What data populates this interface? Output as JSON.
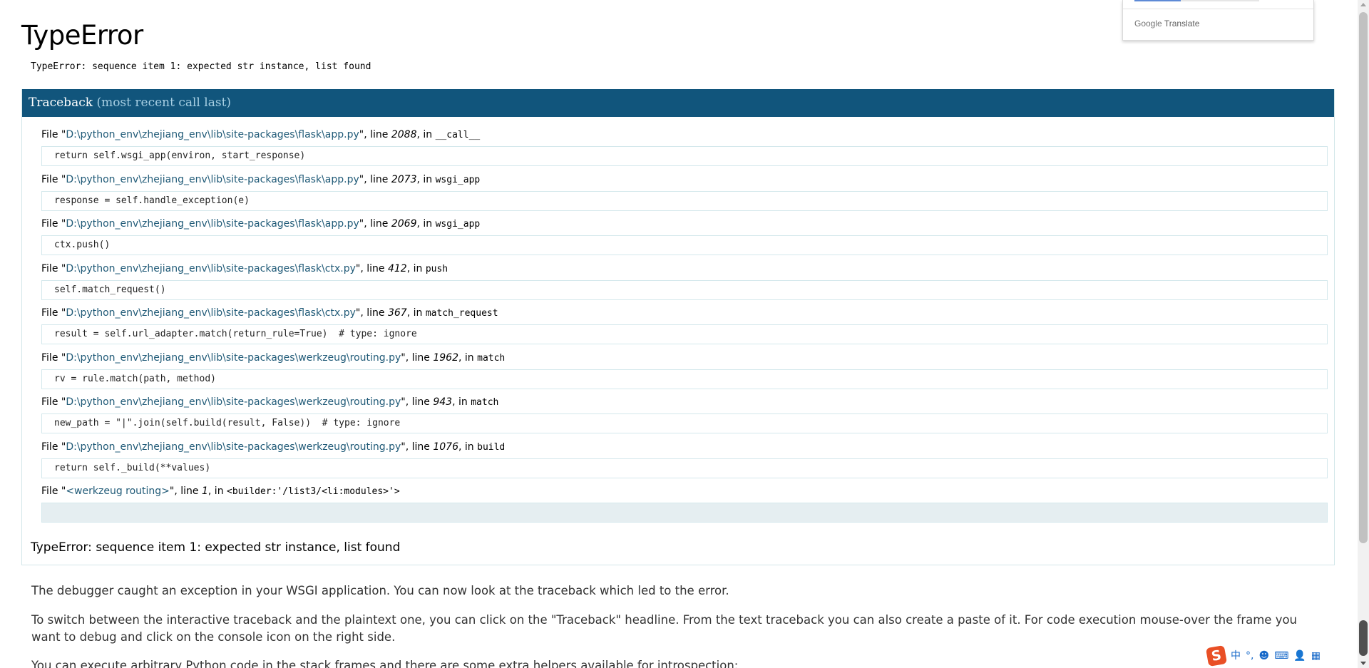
{
  "page": {
    "title": "TypeError",
    "error_message": "TypeError: sequence item 1: expected str instance, list found"
  },
  "traceback": {
    "header_main": "Traceback",
    "header_sub": "(most recent call last)",
    "frames": [
      {
        "file_prefix": "File \"",
        "filename": "D:\\python_env\\zhejiang_env\\lib\\site-packages\\flask\\app.py",
        "line_label": "\", line ",
        "lineno": "2088",
        "in_label": ", in ",
        "function": "__call__",
        "code": "return self.wsgi_app(environ, start_response)"
      },
      {
        "file_prefix": "File \"",
        "filename": "D:\\python_env\\zhejiang_env\\lib\\site-packages\\flask\\app.py",
        "line_label": "\", line ",
        "lineno": "2073",
        "in_label": ", in ",
        "function": "wsgi_app",
        "code": "response = self.handle_exception(e)"
      },
      {
        "file_prefix": "File \"",
        "filename": "D:\\python_env\\zhejiang_env\\lib\\site-packages\\flask\\app.py",
        "line_label": "\", line ",
        "lineno": "2069",
        "in_label": ", in ",
        "function": "wsgi_app",
        "code": "ctx.push()"
      },
      {
        "file_prefix": "File \"",
        "filename": "D:\\python_env\\zhejiang_env\\lib\\site-packages\\flask\\ctx.py",
        "line_label": "\", line ",
        "lineno": "412",
        "in_label": ", in ",
        "function": "push",
        "code": "self.match_request()"
      },
      {
        "file_prefix": "File \"",
        "filename": "D:\\python_env\\zhejiang_env\\lib\\site-packages\\flask\\ctx.py",
        "line_label": "\", line ",
        "lineno": "367",
        "in_label": ", in ",
        "function": "match_request",
        "code": "result = self.url_adapter.match(return_rule=True)  # type: ignore"
      },
      {
        "file_prefix": "File \"",
        "filename": "D:\\python_env\\zhejiang_env\\lib\\site-packages\\werkzeug\\routing.py",
        "line_label": "\", line ",
        "lineno": "1962",
        "in_label": ", in ",
        "function": "match",
        "code": "rv = rule.match(path, method)"
      },
      {
        "file_prefix": "File \"",
        "filename": "D:\\python_env\\zhejiang_env\\lib\\site-packages\\werkzeug\\routing.py",
        "line_label": "\", line ",
        "lineno": "943",
        "in_label": ", in ",
        "function": "match",
        "code": "new_path = \"|\".join(self.build(result, False))  # type: ignore"
      },
      {
        "file_prefix": "File \"",
        "filename": "D:\\python_env\\zhejiang_env\\lib\\site-packages\\werkzeug\\routing.py",
        "line_label": "\", line ",
        "lineno": "1076",
        "in_label": ", in ",
        "function": "build",
        "code": "return self._build(**values)"
      },
      {
        "file_prefix": "File \"",
        "filename": "<werkzeug routing>",
        "line_label": "\", line ",
        "lineno": "1",
        "in_label": ", in ",
        "function": "<builder:'/list3/<li:modules>'>",
        "code": ""
      }
    ],
    "final_exception": "TypeError: sequence item 1: expected str instance, list found"
  },
  "explanation": {
    "paragraph_1": "The debugger caught an exception in your WSGI application. You can now look at the traceback which led to the error.",
    "paragraph_2": "To switch between the interactive traceback and the plaintext one, you can click on the \"Traceback\" headline. From the text traceback you can also create a paste of it. For code execution mouse-over the frame you want to debug and click on the console icon on the right side.",
    "paragraph_3": "You can execute arbitrary Python code in the stack frames and there are some extra helpers available for introspection:"
  },
  "google_translate": {
    "brand": "Google",
    "label": "Translate"
  },
  "ime_toolbar": {
    "logo_icon": "sogou-logo-icon",
    "logo_glyph": "S",
    "chinese_mode": "中",
    "punctuation": "°,",
    "emoji_icon": "☻",
    "keyboard_icon": "⌨",
    "user_icon": "👤",
    "grid_icon": "▦"
  }
}
